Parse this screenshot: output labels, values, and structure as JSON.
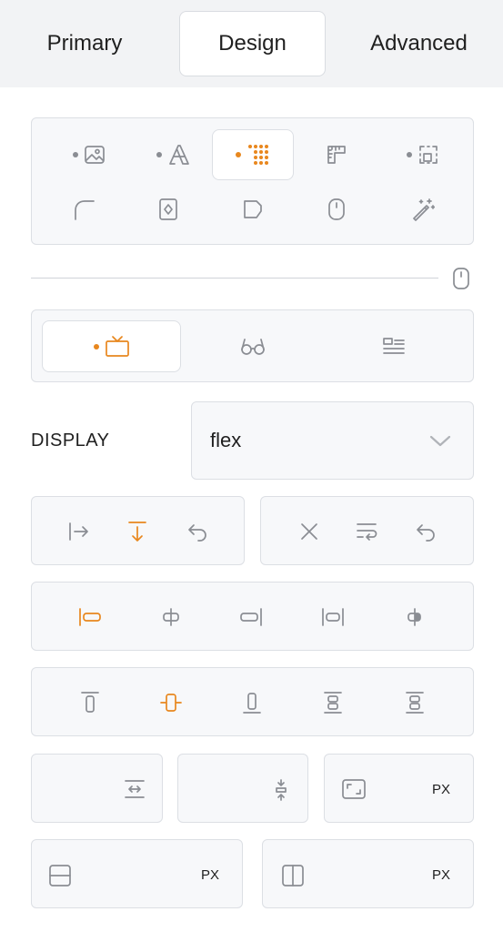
{
  "tabs": [
    {
      "label": "Primary",
      "active": false
    },
    {
      "label": "Design",
      "active": true
    },
    {
      "label": "Advanced",
      "active": false
    }
  ],
  "design_sections": {
    "row1": [
      "image-icon",
      "typography-icon",
      "grid-dots-icon",
      "ruler-icon",
      "dashed-square-icon"
    ],
    "row2": [
      "corner-radius-icon",
      "card-icon",
      "shape-icon",
      "mouse-icon",
      "magic-wand-icon"
    ],
    "active": "grid-dots-icon"
  },
  "devices": [
    "desktop-icon",
    "glasses-icon",
    "list-icon"
  ],
  "display": {
    "label": "DISPLAY",
    "value": "flex"
  },
  "units": {
    "grid_gap": "PX",
    "row_size": "PX",
    "column_size": "PX"
  },
  "colors": {
    "accent": "#e8871e",
    "icon": "#8a8d93",
    "border": "#dcdfe4",
    "panel": "#f7f8fa"
  }
}
